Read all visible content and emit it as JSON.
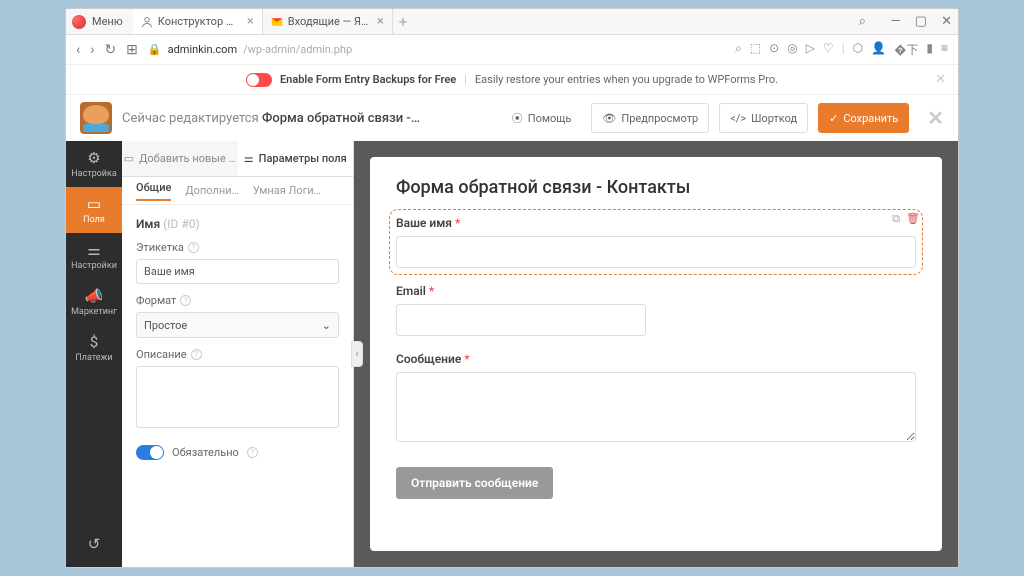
{
  "tabs": [
    {
      "title": "Конструктор WPForms ‹ A"
    },
    {
      "title": "Входящие — Яндекс Поч…"
    }
  ],
  "menu": "Меню",
  "address": {
    "host": "adminkin.com",
    "path": "/wp-admin/admin.php"
  },
  "promo": {
    "bold": "Enable Form Entry Backups for Free",
    "rest": "Easily restore your entries when you upgrade to WPForms Pro."
  },
  "header": {
    "editing_prefix": "Сейчас редактируется",
    "editing_title": "Форма обратной связи -…",
    "help": "Помощь",
    "preview": "Предпросмотр",
    "shortcode": "Шорткод",
    "save": "Сохранить"
  },
  "vnav": [
    "Настройка",
    "Поля",
    "Настройки",
    "Маркетинг",
    "Платежи"
  ],
  "sp": {
    "add": "Добавить новые …",
    "options": "Параметры поля",
    "sub": [
      "Общие",
      "Дополни…",
      "Умная Логи…"
    ],
    "name_label": "Имя",
    "name_id": "(ID #0)",
    "etiketka": "Этикетка",
    "etiketka_val": "Ваше имя",
    "format": "Формат",
    "format_val": "Простое",
    "desc": "Описание",
    "required": "Обязательно"
  },
  "form": {
    "title": "Форма обратной связи - Контакты",
    "name": "Ваше имя",
    "email": "Email",
    "message": "Сообщение",
    "submit": "Отправить сообщение"
  }
}
